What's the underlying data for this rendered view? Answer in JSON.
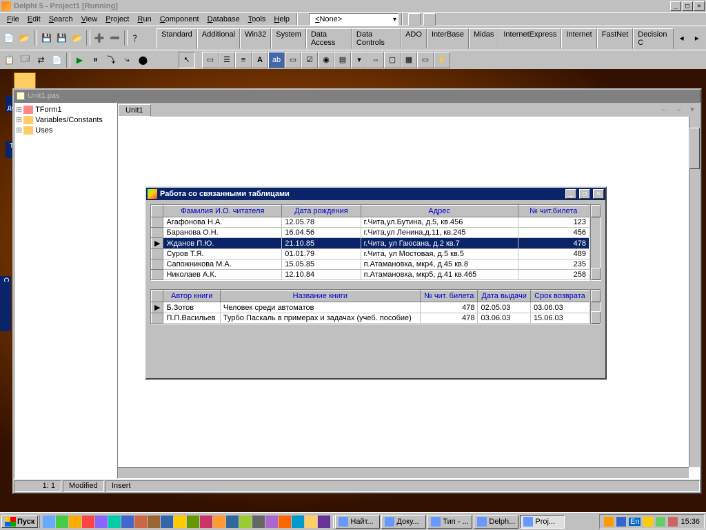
{
  "title": "Delphi 5 - Project1 [Running]",
  "menu": [
    "File",
    "Edit",
    "Search",
    "View",
    "Project",
    "Run",
    "Component",
    "Database",
    "Tools",
    "Help"
  ],
  "combo": "<None>",
  "comp_tabs": [
    "Standard",
    "Additional",
    "Win32",
    "System",
    "Data Access",
    "Data Controls",
    "ADO",
    "InterBase",
    "Midas",
    "InternetExpress",
    "Internet",
    "FastNet",
    "Decision C"
  ],
  "desktop_icons": [
    "Мои документы",
    "Точечный рисунок"
  ],
  "code_win": {
    "title": "Unit1.pas",
    "tree": [
      "TForm1",
      "Variables/Constants",
      "Uses"
    ],
    "tab": "Unit1",
    "status": {
      "pos": "1:   1",
      "mod": "Modified",
      "ins": "Insert"
    }
  },
  "form_win": {
    "title": "Работа со связанными таблицами",
    "grid1": {
      "cols": [
        "Фамилия И.О. читателя",
        "Дата рождения",
        "Адрес",
        "№ чит.билета"
      ],
      "rows": [
        {
          "sel": false,
          "c": [
            "Агафонова Н.А.",
            "12.05.78",
            "г.Чита,ул.Бутина, д.5, кв.456",
            "123"
          ]
        },
        {
          "sel": false,
          "c": [
            "Баранова  О.Н.",
            "16.04.56",
            "г.Чита,ул Ленина,д.11, кв.245",
            "456"
          ]
        },
        {
          "sel": true,
          "c": [
            "Жданов П.Ю.",
            "21.10.85",
            "г.Чита, ул Гаюсана, д.2  кв.7",
            "478"
          ]
        },
        {
          "sel": false,
          "c": [
            "Суров Т.Я.",
            "01.01.79",
            "г.Чита, ул Мостовая, д.5  кв.5",
            "489"
          ]
        },
        {
          "sel": false,
          "c": [
            "Сапожникова М.А.",
            "15.05.85",
            "п.Атамановка, мкр4, д.45 кв.8",
            "235"
          ]
        },
        {
          "sel": false,
          "c": [
            "Николаев А.К.",
            "12.10.84",
            "п.Атамановка, мкр5, д.41 кв.465",
            "258"
          ]
        }
      ]
    },
    "grid2": {
      "cols": [
        "Автор книги",
        "Название книги",
        "№ чит. билета",
        "Дата выдачи",
        "Срок возврата"
      ],
      "rows": [
        {
          "mark": true,
          "c": [
            "Б.Зотов",
            "Человек среди автоматов",
            "478",
            "02.05.03",
            "03.06.03"
          ]
        },
        {
          "mark": false,
          "c": [
            "П.П.Васильев",
            "Турбо Паскаль в примерах и задачах (учеб. пособие)",
            "478",
            "03.06.03",
            "15.06.03"
          ]
        }
      ]
    }
  },
  "taskbar": {
    "start": "Пуск",
    "tasks": [
      {
        "label": "Найт...",
        "act": false
      },
      {
        "label": "Доку...",
        "act": false
      },
      {
        "label": "Тип - ...",
        "act": false
      },
      {
        "label": "Delph...",
        "act": false
      },
      {
        "label": "Proj...",
        "act": true
      }
    ],
    "tray_lang": "En",
    "clock": "15:36"
  },
  "leftedge": "C"
}
